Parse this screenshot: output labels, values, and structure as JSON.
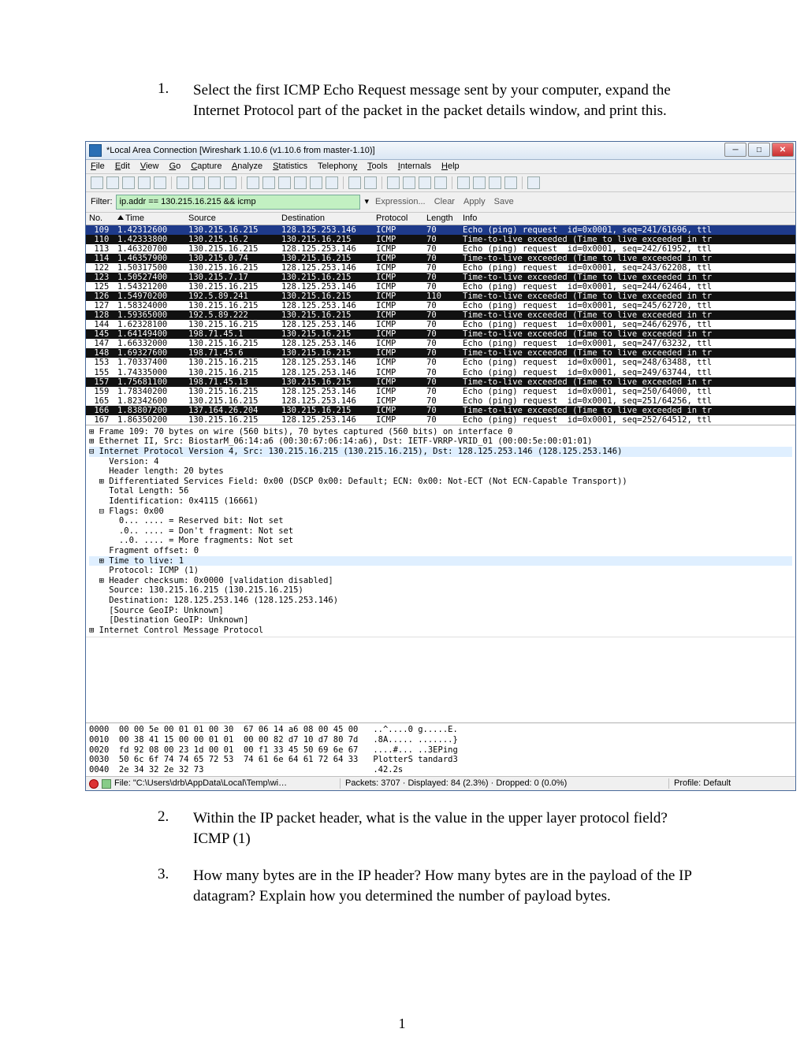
{
  "q1": {
    "num": "1.",
    "text": "Select the first ICMP Echo Request message sent by your computer, expand the Internet Protocol part of the packet in the packet details window, and print this."
  },
  "q2": {
    "num": "2.",
    "text": "Within the IP packet header, what is the value in the upper layer protocol field?",
    "answer": "ICMP (1)"
  },
  "q3": {
    "num": "3.",
    "text": "How many bytes are in the IP header? How many bytes are in the payload of the IP datagram? Explain how you determined the number of payload bytes."
  },
  "page_number": "1",
  "window": {
    "title": "*Local Area Connection  [Wireshark 1.10.6  (v1.10.6 from master-1.10)]",
    "menus": [
      "File",
      "Edit",
      "View",
      "Go",
      "Capture",
      "Analyze",
      "Statistics",
      "Telephony",
      "Tools",
      "Internals",
      "Help"
    ],
    "filter_label": "Filter:",
    "filter_value": "ip.addr == 130.215.16.215 && icmp",
    "filter_btns": [
      "Expression...",
      "Clear",
      "Apply",
      "Save"
    ],
    "cols": {
      "no": "No.",
      "time": "Time",
      "src": "Source",
      "dst": "Destination",
      "proto": "Protocol",
      "len": "Length",
      "info": "Info"
    }
  },
  "packets": [
    {
      "style": "sel",
      "no": "109",
      "time": "1.42312600",
      "src": "130.215.16.215",
      "dst": "128.125.253.146",
      "proto": "ICMP",
      "len": "70",
      "info": "Echo (ping) request  id=0x0001, seq=241/61696, ttl"
    },
    {
      "style": "ttl",
      "no": "110",
      "time": "1.42333800",
      "src": "130.215.16.2",
      "dst": "130.215.16.215",
      "proto": "ICMP",
      "len": "70",
      "info": "Time-to-live exceeded (Time to live exceeded in tr"
    },
    {
      "style": "",
      "no": "113",
      "time": "1.46320700",
      "src": "130.215.16.215",
      "dst": "128.125.253.146",
      "proto": "ICMP",
      "len": "70",
      "info": "Echo (ping) request  id=0x0001, seq=242/61952, ttl"
    },
    {
      "style": "ttl",
      "no": "114",
      "time": "1.46357900",
      "src": "130.215.0.74",
      "dst": "130.215.16.215",
      "proto": "ICMP",
      "len": "70",
      "info": "Time-to-live exceeded (Time to live exceeded in tr"
    },
    {
      "style": "",
      "no": "122",
      "time": "1.50317500",
      "src": "130.215.16.215",
      "dst": "128.125.253.146",
      "proto": "ICMP",
      "len": "70",
      "info": "Echo (ping) request  id=0x0001, seq=243/62208, ttl"
    },
    {
      "style": "ttl",
      "no": "123",
      "time": "1.50527400",
      "src": "130.215.7.17",
      "dst": "130.215.16.215",
      "proto": "ICMP",
      "len": "70",
      "info": "Time-to-live exceeded (Time to live exceeded in tr"
    },
    {
      "style": "",
      "no": "125",
      "time": "1.54321200",
      "src": "130.215.16.215",
      "dst": "128.125.253.146",
      "proto": "ICMP",
      "len": "70",
      "info": "Echo (ping) request  id=0x0001, seq=244/62464, ttl"
    },
    {
      "style": "ttl",
      "no": "126",
      "time": "1.54970200",
      "src": "192.5.89.241",
      "dst": "130.215.16.215",
      "proto": "ICMP",
      "len": "110",
      "info": "Time-to-live exceeded (Time to live exceeded in tr"
    },
    {
      "style": "",
      "no": "127",
      "time": "1.58324000",
      "src": "130.215.16.215",
      "dst": "128.125.253.146",
      "proto": "ICMP",
      "len": "70",
      "info": "Echo (ping) request  id=0x0001, seq=245/62720, ttl"
    },
    {
      "style": "ttl",
      "no": "128",
      "time": "1.59365000",
      "src": "192.5.89.222",
      "dst": "130.215.16.215",
      "proto": "ICMP",
      "len": "70",
      "info": "Time-to-live exceeded (Time to live exceeded in tr"
    },
    {
      "style": "",
      "no": "144",
      "time": "1.62328100",
      "src": "130.215.16.215",
      "dst": "128.125.253.146",
      "proto": "ICMP",
      "len": "70",
      "info": "Echo (ping) request  id=0x0001, seq=246/62976, ttl"
    },
    {
      "style": "ttl",
      "no": "145",
      "time": "1.64149400",
      "src": "198.71.45.1",
      "dst": "130.215.16.215",
      "proto": "ICMP",
      "len": "70",
      "info": "Time-to-live exceeded (Time to live exceeded in tr"
    },
    {
      "style": "",
      "no": "147",
      "time": "1.66332000",
      "src": "130.215.16.215",
      "dst": "128.125.253.146",
      "proto": "ICMP",
      "len": "70",
      "info": "Echo (ping) request  id=0x0001, seq=247/63232, ttl"
    },
    {
      "style": "ttl",
      "no": "148",
      "time": "1.69327600",
      "src": "198.71.45.6",
      "dst": "130.215.16.215",
      "proto": "ICMP",
      "len": "70",
      "info": "Time-to-live exceeded (Time to live exceeded in tr"
    },
    {
      "style": "",
      "no": "153",
      "time": "1.70337400",
      "src": "130.215.16.215",
      "dst": "128.125.253.146",
      "proto": "ICMP",
      "len": "70",
      "info": "Echo (ping) request  id=0x0001, seq=248/63488, ttl"
    },
    {
      "style": "",
      "no": "155",
      "time": "1.74335000",
      "src": "130.215.16.215",
      "dst": "128.125.253.146",
      "proto": "ICMP",
      "len": "70",
      "info": "Echo (ping) request  id=0x0001, seq=249/63744, ttl"
    },
    {
      "style": "ttl",
      "no": "157",
      "time": "1.75681100",
      "src": "198.71.45.13",
      "dst": "130.215.16.215",
      "proto": "ICMP",
      "len": "70",
      "info": "Time-to-live exceeded (Time to live exceeded in tr"
    },
    {
      "style": "",
      "no": "159",
      "time": "1.78340200",
      "src": "130.215.16.215",
      "dst": "128.125.253.146",
      "proto": "ICMP",
      "len": "70",
      "info": "Echo (ping) request  id=0x0001, seq=250/64000, ttl"
    },
    {
      "style": "",
      "no": "165",
      "time": "1.82342600",
      "src": "130.215.16.215",
      "dst": "128.125.253.146",
      "proto": "ICMP",
      "len": "70",
      "info": "Echo (ping) request  id=0x0001, seq=251/64256, ttl"
    },
    {
      "style": "ttl",
      "no": "166",
      "time": "1.83807200",
      "src": "137.164.26.204",
      "dst": "130.215.16.215",
      "proto": "ICMP",
      "len": "70",
      "info": "Time-to-live exceeded (Time to live exceeded in tr"
    },
    {
      "style": "",
      "no": "167",
      "time": "1.86350200",
      "src": "130.215.16.215",
      "dst": "128.125.253.146",
      "proto": "ICMP",
      "len": "70",
      "info": "Echo (ping) request  id=0x0001, seq=252/64512, ttl"
    }
  ],
  "details": [
    {
      "cls": "",
      "t": "⊞ Frame 109: 70 bytes on wire (560 bits), 70 bytes captured (560 bits) on interface 0"
    },
    {
      "cls": "",
      "t": "⊞ Ethernet II, Src: BiostarM_06:14:a6 (00:30:67:06:14:a6), Dst: IETF-VRRP-VRID_01 (00:00:5e:00:01:01)"
    },
    {
      "cls": "hl",
      "t": "⊟ Internet Protocol Version 4, Src: 130.215.16.215 (130.215.16.215), Dst: 128.125.253.146 (128.125.253.146)"
    },
    {
      "cls": "",
      "t": "    Version: 4"
    },
    {
      "cls": "",
      "t": "    Header length: 20 bytes"
    },
    {
      "cls": "",
      "t": "  ⊞ Differentiated Services Field: 0x00 (DSCP 0x00: Default; ECN: 0x00: Not-ECT (Not ECN-Capable Transport))"
    },
    {
      "cls": "",
      "t": "    Total Length: 56"
    },
    {
      "cls": "",
      "t": "    Identification: 0x4115 (16661)"
    },
    {
      "cls": "",
      "t": "  ⊟ Flags: 0x00"
    },
    {
      "cls": "",
      "t": "      0... .... = Reserved bit: Not set"
    },
    {
      "cls": "",
      "t": "      .0.. .... = Don't fragment: Not set"
    },
    {
      "cls": "",
      "t": "      ..0. .... = More fragments: Not set"
    },
    {
      "cls": "",
      "t": "    Fragment offset: 0"
    },
    {
      "cls": "hl",
      "t": "  ⊞ Time to live: 1"
    },
    {
      "cls": "",
      "t": "    Protocol: ICMP (1)"
    },
    {
      "cls": "",
      "t": "  ⊞ Header checksum: 0x0000 [validation disabled]"
    },
    {
      "cls": "",
      "t": "    Source: 130.215.16.215 (130.215.16.215)"
    },
    {
      "cls": "",
      "t": "    Destination: 128.125.253.146 (128.125.253.146)"
    },
    {
      "cls": "",
      "t": "    [Source GeoIP: Unknown]"
    },
    {
      "cls": "",
      "t": "    [Destination GeoIP: Unknown]"
    },
    {
      "cls": "",
      "t": "⊞ Internet Control Message Protocol"
    }
  ],
  "hex": [
    "0000  00 00 5e 00 01 01 00 30  67 06 14 a6 08 00 45 00   ..^....0 g.....E.",
    "0010  00 38 41 15 00 00 01 01  00 00 82 d7 10 d7 80 7d   .8A..... .......}",
    "0020  fd 92 08 00 23 1d 00 01  00 f1 33 45 50 69 6e 67   ....#... ..3EPing",
    "0030  50 6c 6f 74 74 65 72 53  74 61 6e 64 61 72 64 33   PlotterS tandard3",
    "0040  2e 34 32 2e 32 73                                  .42.2s"
  ],
  "status": {
    "file": "File: \"C:\\Users\\drb\\AppData\\Local\\Temp\\wi…",
    "mid": "Packets: 3707 · Displayed: 84 (2.3%) · Dropped: 0 (0.0%)",
    "profile": "Profile: Default"
  }
}
